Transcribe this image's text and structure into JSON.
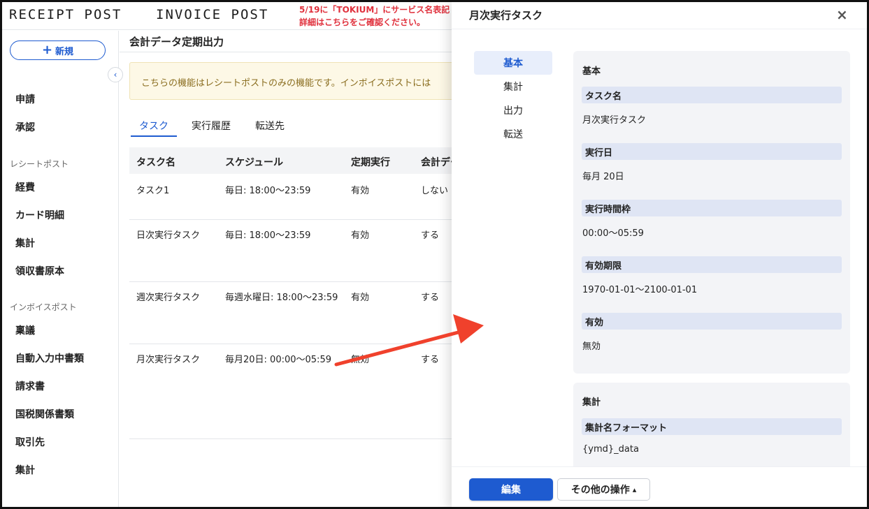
{
  "header": {
    "logo_receipt": "RECEIPT POST",
    "logo_invoice": "INVOICE POST",
    "notice_line1": "5/19に「TOKIUM」にサービス名表記",
    "notice_line2": "詳細はこちらをご確認ください。"
  },
  "sidebar": {
    "new_button": "新規",
    "items_top": [
      "申請",
      "承認"
    ],
    "section_receipt": "レシートポスト",
    "items_receipt": [
      "経費",
      "カード明細",
      "集計",
      "領収書原本"
    ],
    "section_invoice": "インボイスポスト",
    "items_invoice": [
      "稟議",
      "自動入力中書類",
      "請求書",
      "国税関係書類",
      "取引先",
      "集計"
    ]
  },
  "main": {
    "title": "会計データ定期出力",
    "info": "こちらの機能はレシートポストのみの機能です。インボイスポストには",
    "tabs": [
      "タスク",
      "実行履歴",
      "転送先"
    ],
    "columns": [
      "タスク名",
      "スケジュール",
      "定期実行",
      "会計デー"
    ],
    "rows": [
      {
        "name": "タスク1",
        "schedule": "毎日: 18:00〜23:59",
        "enabled": "有効",
        "output": "しない"
      },
      {
        "name": "日次実行タスク",
        "schedule": "毎日: 18:00〜23:59",
        "enabled": "有効",
        "output": "する"
      },
      {
        "name": "週次実行タスク",
        "schedule": "毎週水曜日: 18:00〜23:59",
        "enabled": "有効",
        "output": "する"
      },
      {
        "name": "月次実行タスク",
        "schedule": "毎月20日: 00:00〜05:59",
        "enabled": "無効",
        "output": "する"
      }
    ]
  },
  "drawer": {
    "title": "月次実行タスク",
    "close": "×",
    "nav": [
      "基本",
      "集計",
      "出力",
      "転送"
    ],
    "basic": {
      "title": "基本",
      "fields": [
        {
          "label": "タスク名",
          "value": "月次実行タスク"
        },
        {
          "label": "実行日",
          "value": "毎月 20日"
        },
        {
          "label": "実行時間枠",
          "value": "00:00〜05:59"
        },
        {
          "label": "有効期限",
          "value": "1970-01-01〜2100-01-01"
        },
        {
          "label": "有効",
          "value": "無効"
        }
      ]
    },
    "aggregate": {
      "title": "集計",
      "fields": [
        {
          "label": "集計名フォーマット",
          "value": "{ymd}_data"
        }
      ]
    },
    "edit_button": "編集",
    "other_button": "その他の操作"
  },
  "colors": {
    "primary": "#1e5bd0",
    "notice": "#e0313d",
    "arrow": "#f0412c",
    "label_bg": "#dfe5f4"
  }
}
